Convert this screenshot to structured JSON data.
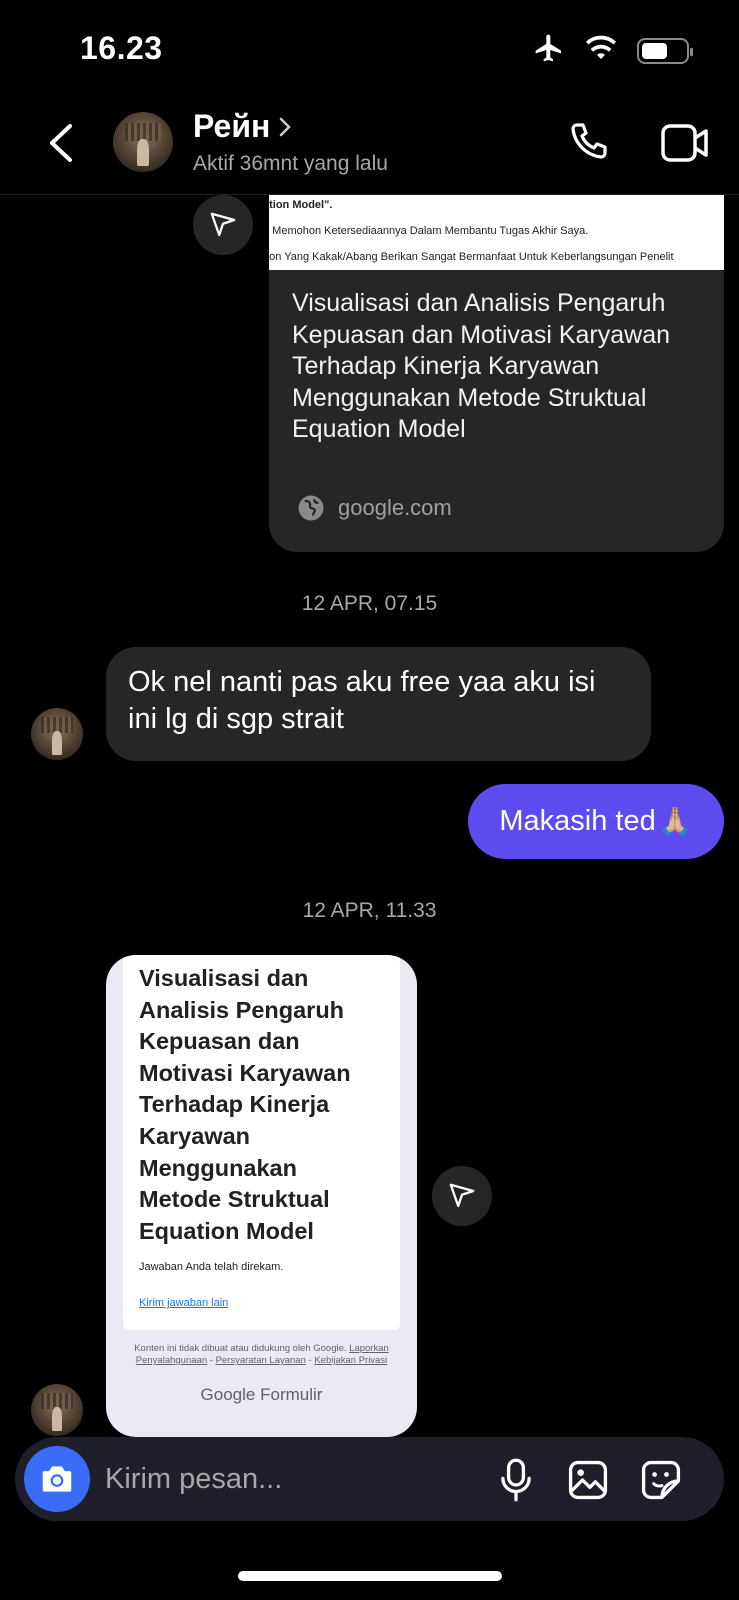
{
  "status_bar": {
    "time": "16.23",
    "icons": [
      "airplane-icon",
      "wifi-icon",
      "battery-icon"
    ],
    "battery_level": 0.6
  },
  "header": {
    "name": "Рейн",
    "status": "Aktif 36mnt yang lalu",
    "icons": [
      "back-arrow-icon",
      "chevron-right-icon",
      "phone-icon",
      "video-camera-icon"
    ]
  },
  "link_preview": {
    "image_lines": [
      "ation Model\".",
      "a Memohon Ketersediaannya Dalam Membantu Tugas Akhir Saya.",
      "bon Yang Kakak/Abang  Berikan Sangat Bermanfaat Untuk Keberlangsungan Penelit"
    ],
    "title": "Visualisasi dan Analisis Pengaruh Kepuasan dan Motivasi Karyawan Terhadap Kinerja Karyawan Menggunakan Metode Struktual Equation Model",
    "domain": "google.com"
  },
  "messages": {
    "timestamp_1": "12 APR, 07.15",
    "incoming_1": "Ok nel nanti pas aku free yaa aku isi ini lg di sgp strait",
    "outgoing_1": "Makasih ted",
    "outgoing_1_emoji": "🙏🏼",
    "timestamp_2": "12 APR, 11.33"
  },
  "form_card": {
    "title": "Visualisasi dan Analisis Pengaruh Kepuasan dan Motivasi Karyawan Terhadap Kinerja Karyawan Menggunakan Metode Struktual Equation Model",
    "recorded_text": "Jawaban Anda telah direkam.",
    "resubmit_link": "Kirim jawaban lain",
    "footer_text": "Konten ini tidak dibuat atau didukung oleh Google.",
    "footer_links": [
      "Laporkan Penyalahgunaan",
      "Persyaratan Layanan",
      "Kebijakan Privasi"
    ],
    "footer_separator": " - ",
    "brand_google": "Google",
    "brand_product": "Formulir"
  },
  "composer": {
    "placeholder": "Kirim pesan...",
    "icons": [
      "camera-icon",
      "microphone-icon",
      "image-icon",
      "sticker-icon"
    ]
  },
  "colors": {
    "background": "#000000",
    "incoming_bubble": "#262628",
    "outgoing_bubble": "#5d4bef",
    "camera_button": "#3b6cf6",
    "secondary_text": "#a8a8a8"
  }
}
